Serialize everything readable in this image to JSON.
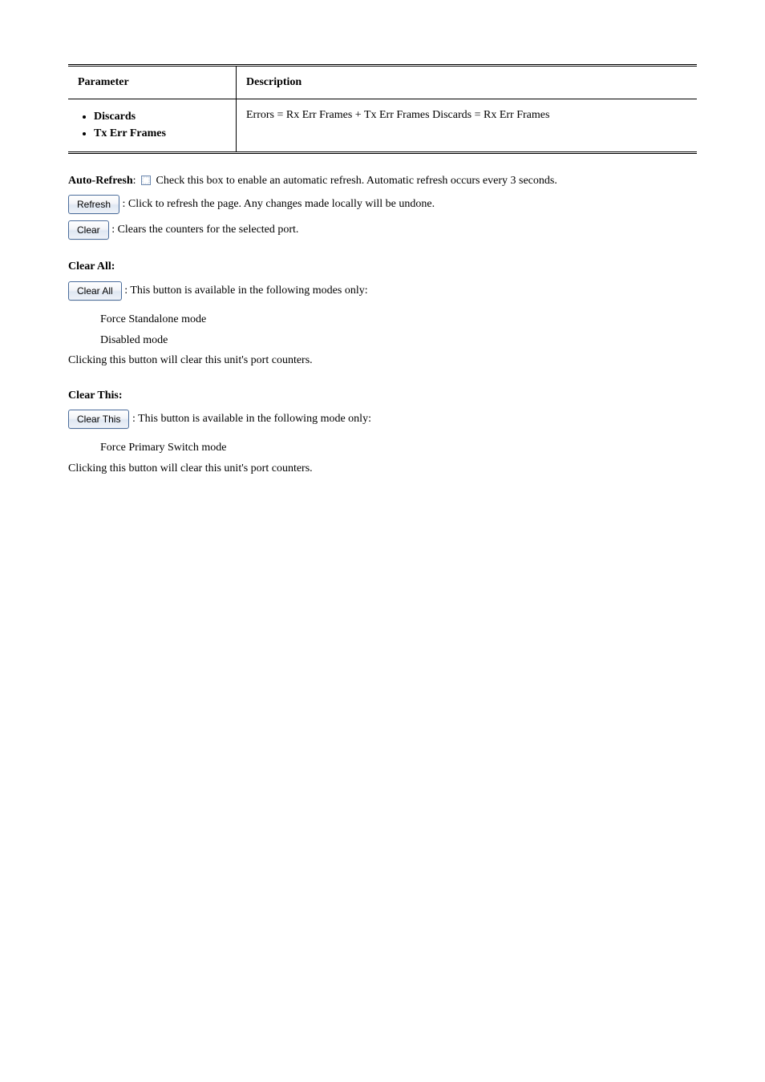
{
  "table": {
    "headers": [
      "Parameter",
      "Description"
    ],
    "row": {
      "bullets": [
        "Discards",
        "Tx Err Frames"
      ],
      "description": "Errors = Rx Err Frames + Tx Err Frames Discards = Rx Err Frames"
    }
  },
  "autoRefresh": {
    "lead": "Auto-Refresh",
    "rest": ":",
    "checkboxAfter": " Check this box to enable an automatic refresh. Automatic refresh occurs every 3 seconds."
  },
  "refresh": {
    "button": "Refresh",
    "desc": ": Click to refresh the page. Any changes made locally will be undone."
  },
  "clear": {
    "button": "Clear",
    "desc": ": Clears the counters for the selected port."
  },
  "clearAll": {
    "heading": "Clear All:",
    "button": "Clear All",
    "desc": ": This button is available in the following modes only:",
    "modes": [
      "Force Standalone mode",
      "Disabled mode"
    ],
    "action": "Clicking this button will clear this unit's port counters."
  },
  "clearThis": {
    "heading": "Clear This:",
    "button": "Clear This",
    "desc": ": This button is available in the following mode only:",
    "modes": [
      "Force Primary Switch mode"
    ],
    "action": "Clicking this button will clear this unit's port counters."
  }
}
